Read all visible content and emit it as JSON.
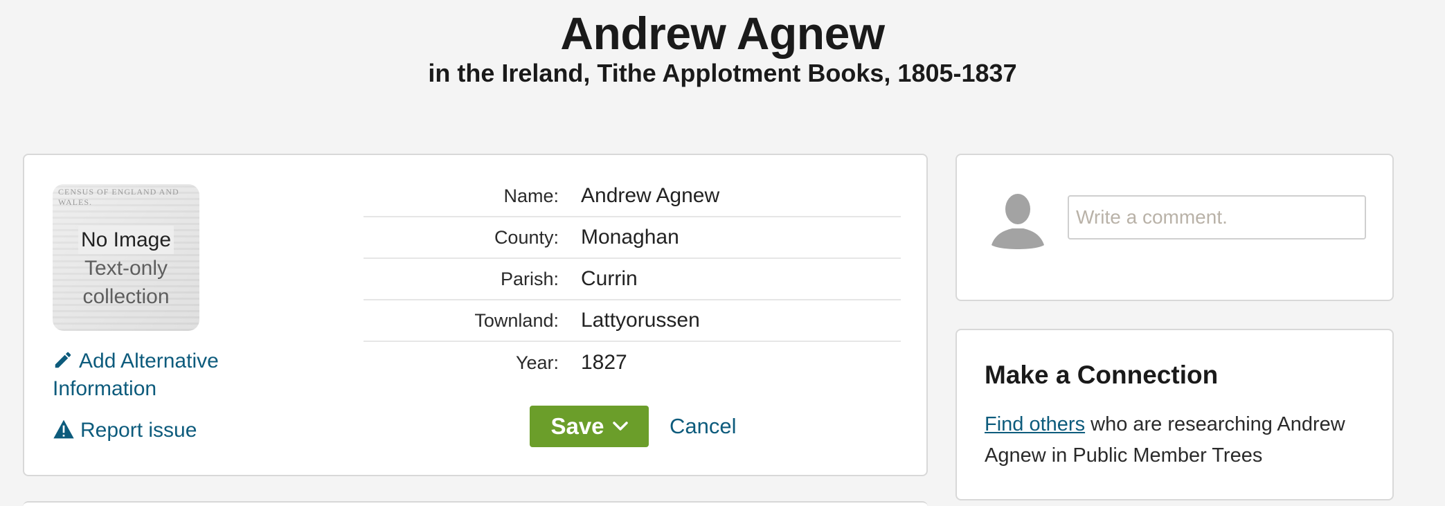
{
  "header": {
    "title": "Andrew Agnew",
    "subtitle": "in the Ireland, Tithe Applotment Books, 1805-1837"
  },
  "thumbnail": {
    "header_text": "CENSUS OF ENGLAND AND WALES.",
    "main_text": "No Image",
    "sub_line1": "Text-only",
    "sub_line2": "collection"
  },
  "links": {
    "add_alternative": "Add Alternative Information",
    "report_issue": "Report issue"
  },
  "fields": [
    {
      "label": "Name:",
      "value": "Andrew Agnew"
    },
    {
      "label": "County:",
      "value": "Monaghan"
    },
    {
      "label": "Parish:",
      "value": "Currin"
    },
    {
      "label": "Townland:",
      "value": "Lattyorussen"
    },
    {
      "label": "Year:",
      "value": "1827"
    }
  ],
  "actions": {
    "save_label": "Save",
    "cancel_label": "Cancel"
  },
  "comment": {
    "placeholder": "Write a comment."
  },
  "connection": {
    "title": "Make a Connection",
    "link_text": "Find others",
    "rest_text": " who are researching Andrew Agnew in Public Member Trees"
  },
  "colors": {
    "link": "#0d5b7c",
    "save_button": "#6b9e2a",
    "background": "#f4f4f4"
  },
  "icons": {
    "add_alternative": "pencil-icon",
    "report_issue": "warning-icon",
    "save_dropdown": "chevron-down-icon",
    "avatar": "user-silhouette-icon"
  }
}
